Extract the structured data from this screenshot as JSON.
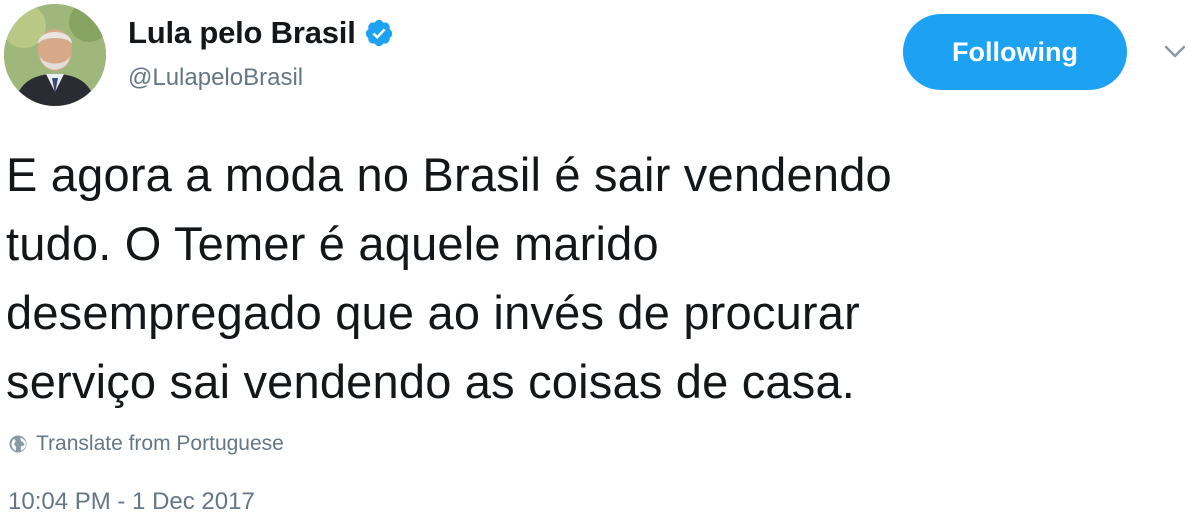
{
  "user": {
    "display_name": "Lula pelo Brasil",
    "handle": "@LulapeloBrasil",
    "verified": true
  },
  "actions": {
    "follow_label": "Following"
  },
  "tweet": {
    "lines": [
      "E agora a moda no Brasil é sair vendendo",
      "tudo. O Temer é aquele marido",
      "desempregado que ao invés de procurar",
      "serviço sai vendendo as coisas de casa."
    ],
    "translate_label": "Translate from Portuguese",
    "timestamp": "10:04 PM - 1 Dec 2017"
  },
  "colors": {
    "accent": "#1da1f2",
    "text_primary": "#14171a",
    "text_secondary": "#657786"
  },
  "icons": {
    "verified": "verified-badge-icon",
    "caret": "chevron-down-icon",
    "translate": "globe-icon"
  }
}
